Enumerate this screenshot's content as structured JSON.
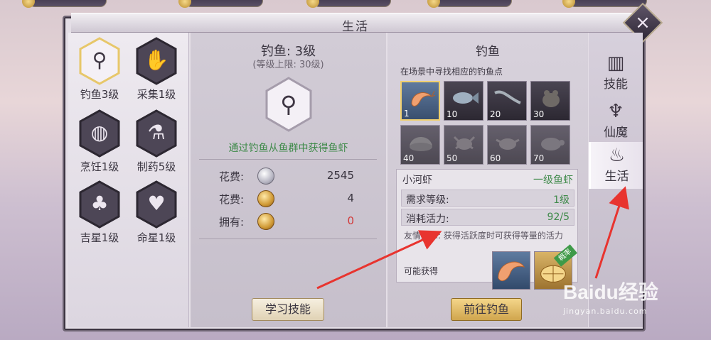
{
  "window": {
    "title": "生活"
  },
  "skills": [
    {
      "label": "钓鱼3级",
      "icon": "fishing-hook-icon",
      "glyph": "⚲",
      "selected": true
    },
    {
      "label": "采集1级",
      "icon": "hand-gather-icon",
      "glyph": "✋",
      "selected": false
    },
    {
      "label": "烹饪1级",
      "icon": "frying-pan-icon",
      "glyph": "◍",
      "selected": false
    },
    {
      "label": "制药5级",
      "icon": "mortar-pestle-icon",
      "glyph": "⚗",
      "selected": false
    },
    {
      "label": "吉星1级",
      "icon": "lucky-star-figure-icon",
      "glyph": "♣",
      "selected": false
    },
    {
      "label": "命星1级",
      "icon": "fate-star-figure-icon",
      "glyph": "♥",
      "selected": false
    }
  ],
  "detail": {
    "title": "钓鱼: 3级",
    "subtitle": "(等级上限: 30级)",
    "icon": "fishing-hook-icon",
    "glyph": "⚲",
    "description": "通过钓鱼从鱼群中获得鱼虾",
    "costs": [
      {
        "label": "花费:",
        "icon": "silver-coin-icon",
        "value": "2545",
        "value_color": "#3a3540"
      },
      {
        "label": "花费:",
        "icon": "gold-coin-icon",
        "value": "4",
        "value_color": "#3a3540"
      },
      {
        "label": "拥有:",
        "icon": "gold-coin-icon",
        "value": "0",
        "value_color": "#d23a3a"
      }
    ],
    "learn_button": "学习技能"
  },
  "fishing": {
    "title": "钓鱼",
    "hint": "在场景中寻找相应的钓鱼点",
    "spots": [
      {
        "level": "1",
        "icon": "shrimp-icon",
        "selected": true
      },
      {
        "level": "10",
        "icon": "fish-icon",
        "selected": false
      },
      {
        "level": "20",
        "icon": "eel-icon",
        "selected": false
      },
      {
        "level": "30",
        "icon": "frog-icon",
        "selected": false
      },
      {
        "level": "40",
        "icon": "clam-icon",
        "selected": false
      },
      {
        "level": "50",
        "icon": "crab-icon",
        "selected": false
      },
      {
        "level": "60",
        "icon": "crab-icon",
        "selected": false
      },
      {
        "level": "70",
        "icon": "turtle-icon",
        "selected": false
      }
    ],
    "item": {
      "name": "小河虾",
      "grade": "一级鱼虾",
      "rows": [
        {
          "label": "需求等级:",
          "value": "1级"
        },
        {
          "label": "消耗活力:",
          "value": "92/5"
        }
      ],
      "tip": "友情提示: 获得活跃度时可获得等量的活力",
      "may_obtain": "可能获得",
      "badge": "概率"
    },
    "go_button": "前往钓鱼"
  },
  "tabs": [
    {
      "label": "技能",
      "icon": "skill-book-icon",
      "glyph": "▥",
      "active": false
    },
    {
      "label": "仙魔",
      "icon": "immortal-demon-icon",
      "glyph": "♆",
      "active": false
    },
    {
      "label": "生活",
      "icon": "cooking-pot-icon",
      "glyph": "♨",
      "active": true
    }
  ],
  "watermark": {
    "main": "Baidu经验",
    "sub": "jingyan.baidu.com"
  },
  "colors": {
    "accent_green": "#3f8a4a",
    "warning_red": "#d23a3a",
    "arrow_red": "#e8342f"
  }
}
